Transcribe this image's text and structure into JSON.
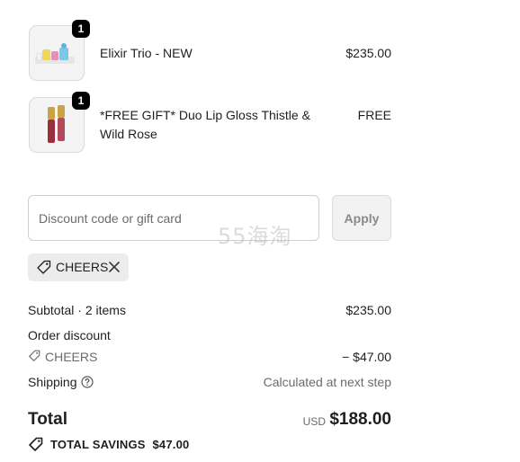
{
  "items": [
    {
      "name": "Elixir Trio - NEW",
      "price": "$235.00",
      "qty": "1"
    },
    {
      "name": "*FREE GIFT* Duo Lip Gloss Thistle & Wild Rose",
      "price": "FREE",
      "qty": "1"
    }
  ],
  "discount": {
    "placeholder": "Discount code or gift card",
    "apply_label": "Apply",
    "watermark": "55海淘"
  },
  "applied_code": {
    "label": "CHEERS"
  },
  "summary": {
    "subtotal_label": "Subtotal · 2 items",
    "subtotal_value": "$235.00",
    "order_discount_label": "Order discount",
    "discount_code_label": "CHEERS",
    "discount_value": "− $47.00",
    "shipping_label": "Shipping",
    "shipping_value": "Calculated at next step",
    "total_label": "Total",
    "currency": "USD",
    "total_value": "$188.00",
    "savings_label": "TOTAL SAVINGS",
    "savings_value": "$47.00"
  },
  "icons": {
    "tag": "tag-icon",
    "close": "close-icon",
    "help": "help-circle-icon"
  }
}
